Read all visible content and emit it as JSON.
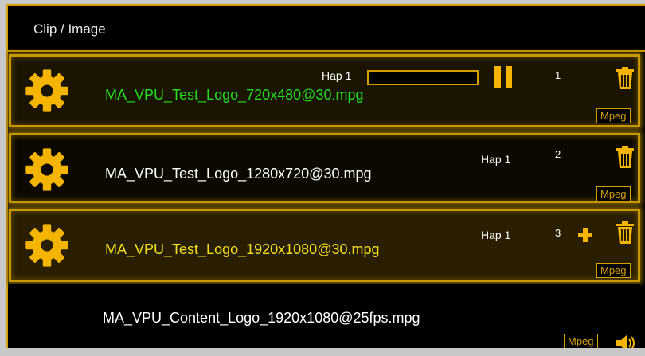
{
  "header": {
    "title": "Clip / Image"
  },
  "rows": [
    {
      "filename": "MA_VPU_Test_Logo_720x480@30.mpg",
      "codec": "Hap 1",
      "number": "1",
      "format": "Mpeg",
      "text_color": "#22dd22",
      "state": "playing"
    },
    {
      "filename": "MA_VPU_Test_Logo_1280x720@30.mpg",
      "codec": "Hap 1",
      "number": "2",
      "format": "Mpeg",
      "text_color": "#ffffff",
      "state": "idle"
    },
    {
      "filename": "MA_VPU_Test_Logo_1920x1080@30.mpg",
      "codec": "Hap 1",
      "number": "3",
      "format": "Mpeg",
      "text_color": "#f0e020",
      "state": "selected"
    },
    {
      "filename": "MA_VPU_Content_Logo_1920x1080@25fps.mpg",
      "codec": "",
      "number": "",
      "format": "Mpeg",
      "text_color": "#ffffff",
      "state": "idle"
    }
  ],
  "colors": {
    "accent": "#d4a000",
    "icon": "#f5b400",
    "playing_text": "#22dd22",
    "selected_text": "#f0e020"
  },
  "icons": [
    "gear-icon",
    "pause-icon",
    "trash-icon",
    "plus-icon",
    "speaker-icon"
  ]
}
